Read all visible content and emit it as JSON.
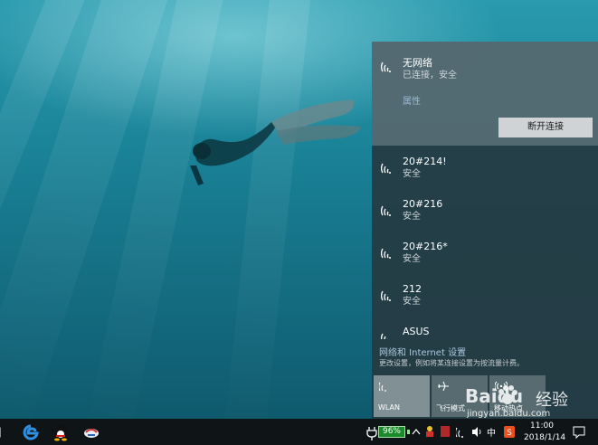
{
  "flyout": {
    "connected": {
      "name": "无网络",
      "status": "已连接，安全",
      "properties_label": "属性",
      "disconnect_label": "断开连接"
    },
    "networks": [
      {
        "name": "20#214!",
        "status": "安全"
      },
      {
        "name": "20#216",
        "status": "安全"
      },
      {
        "name": "20#216*",
        "status": "安全"
      },
      {
        "name": "212",
        "status": "安全"
      },
      {
        "name": "ASUS",
        "status": ""
      }
    ],
    "settings": {
      "link_label": "网络和 Internet 设置",
      "description": "更改设置，例如将某连接设置为按流量计费。"
    },
    "quick_actions": [
      {
        "label": "WLAN",
        "icon": "wifi-icon",
        "active": true
      },
      {
        "label": "飞行模式",
        "icon": "airplane-icon",
        "active": false
      },
      {
        "label": "移动热点",
        "icon": "hotspot-icon",
        "active": false
      }
    ]
  },
  "taskbar": {
    "pinned": [
      {
        "icon": "edge-icon"
      },
      {
        "icon": "qq-icon"
      },
      {
        "icon": "network-tool-icon"
      }
    ],
    "battery_percent": "96%",
    "ime_label": "中",
    "clock": {
      "time": "11:00",
      "date": "2018/1/14"
    }
  },
  "watermark": {
    "brand": "Baidu",
    "brand_cn": "经验",
    "url": "jingyan.baidu.com"
  },
  "colors": {
    "flyout_bg": "#263a42",
    "selected_bg": "#788c94",
    "link": "#a9c6de",
    "battery_green": "#1a8a2a",
    "taskbar_bg": "#0f1417"
  }
}
